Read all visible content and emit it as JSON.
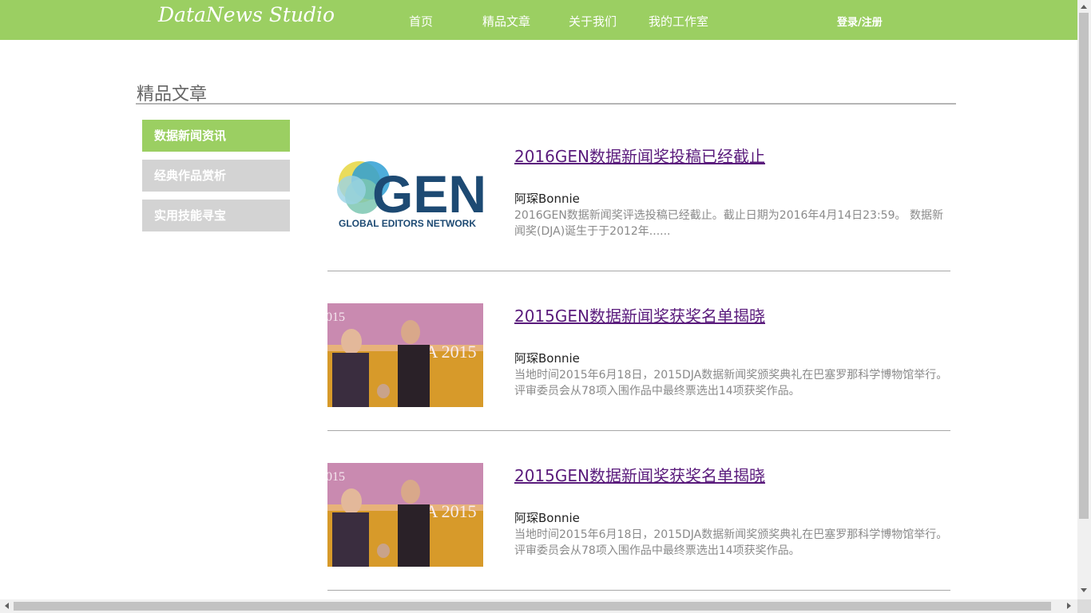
{
  "header": {
    "logo": "DataNews Studio",
    "nav": [
      {
        "label": "首页"
      },
      {
        "label": "精品文章"
      },
      {
        "label": "关于我们"
      },
      {
        "label": "我的工作室"
      }
    ],
    "login": "登录/注册"
  },
  "page": {
    "title": "精品文章"
  },
  "sidebar": {
    "items": [
      {
        "label": "数据新闻资讯",
        "active": true
      },
      {
        "label": "经典作品赏析",
        "active": false
      },
      {
        "label": "实用技能寻宝",
        "active": false
      }
    ]
  },
  "articles": [
    {
      "title": "2016GEN数据新闻奖投稿已经截止",
      "author": "阿琛Bonnie",
      "summary": "2016GEN数据新闻奖评选投稿已经截止。截止日期为2016年4月14日23:59。 数据新闻奖(DJA)诞生于于2012年......",
      "image": {
        "kind": "gen-logo",
        "logo_text": "GEN",
        "logo_caption": "GLOBAL EDITORS NETWORK"
      }
    },
    {
      "title": "2015GEN数据新闻奖获奖名单揭晓",
      "author": "阿琛Bonnie",
      "summary": "当地时间2015年6月18日，2015DJA数据新闻奖颁奖典礼在巴塞罗那科学博物馆举行。 评审委员会从78项入围作品中最终票选出14项获奖作品。",
      "image": {
        "kind": "ceremony-photo",
        "backdrop_text": "DJA 2015",
        "corner_text": "015"
      }
    },
    {
      "title": "2015GEN数据新闻奖获奖名单揭晓",
      "author": "阿琛Bonnie",
      "summary": "当地时间2015年6月18日，2015DJA数据新闻奖颁奖典礼在巴塞罗那科学博物馆举行。 评审委员会从78项入围作品中最终票选出14项获奖作品。",
      "image": {
        "kind": "ceremony-photo",
        "backdrop_text": "DJA 2015",
        "corner_text": "015"
      }
    }
  ],
  "colors": {
    "header": "#9bcf62",
    "sidebar_active": "#9bcf62",
    "sidebar_inactive": "#d3d3d3",
    "article_link": "#5a1b7c",
    "summary_text": "#8a8a8a"
  }
}
